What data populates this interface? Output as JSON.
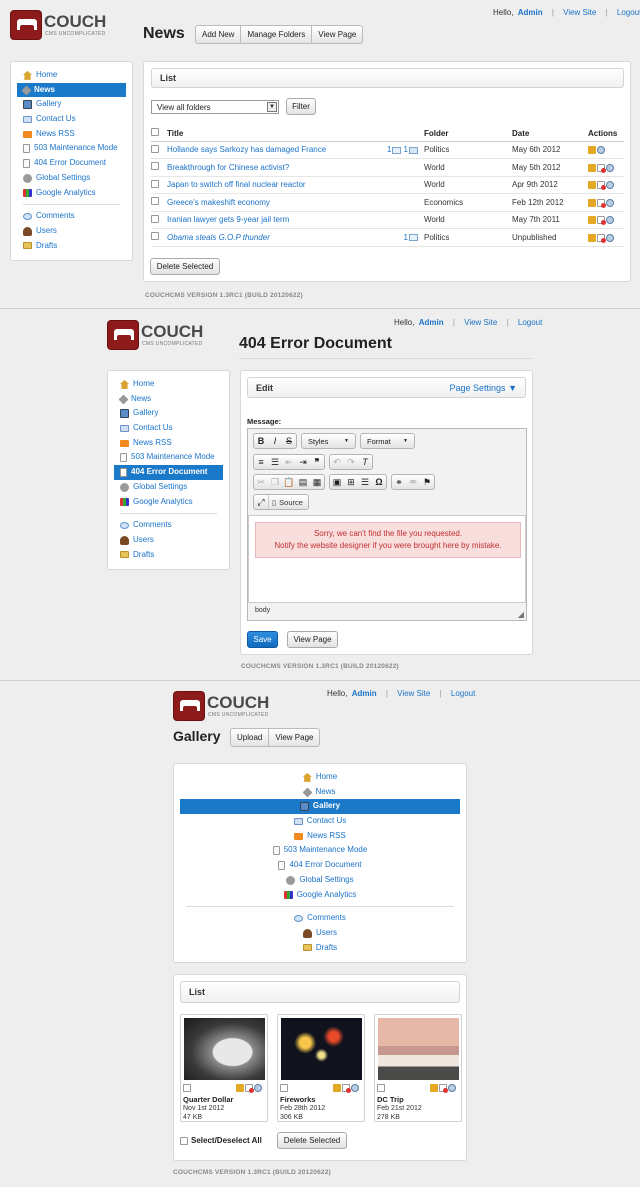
{
  "logo": {
    "text": "COUCH",
    "tagline": "CMS UNCOMPLICATED"
  },
  "account": {
    "greeting": "Hello,",
    "user": "Admin",
    "view_site": "View Site",
    "logout": "Logout"
  },
  "nav": {
    "items": [
      {
        "label": "Home",
        "icon": "home-icon"
      },
      {
        "label": "News",
        "icon": "tag-icon"
      },
      {
        "label": "Gallery",
        "icon": "gallery-icon"
      },
      {
        "label": "Contact Us",
        "icon": "mail-icon"
      },
      {
        "label": "News RSS",
        "icon": "rss-icon"
      },
      {
        "label": "503 Maintenance Mode",
        "icon": "document-icon"
      },
      {
        "label": "404 Error Document",
        "icon": "document-icon"
      },
      {
        "label": "Global Settings",
        "icon": "gear-icon"
      },
      {
        "label": "Google Analytics",
        "icon": "chart-icon"
      }
    ],
    "extra": [
      {
        "label": "Comments",
        "icon": "comment-icon"
      },
      {
        "label": "Users",
        "icon": "user-icon"
      },
      {
        "label": "Drafts",
        "icon": "folder-icon"
      }
    ]
  },
  "footer": "COUCHCMS VERSION 1.3RC1 (BUILD 20120622)",
  "news": {
    "title": "News",
    "buttons": [
      "Add New",
      "Manage Folders",
      "View Page"
    ],
    "panel_title": "List",
    "folder_select": "View all folders",
    "filter_label": "Filter",
    "columns": {
      "title": "Title",
      "folder": "Folder",
      "date": "Date",
      "actions": "Actions"
    },
    "rows": [
      {
        "title": "Hollande says Sarkozy has damaged France",
        "comments_a": "1",
        "comments_b": "1",
        "folder": "Politics",
        "date": "May 6th 2012",
        "italic": false
      },
      {
        "title": "Breakthrough for Chinese activist?",
        "comments_a": "",
        "comments_b": "",
        "folder": "World",
        "date": "May 5th 2012",
        "italic": false
      },
      {
        "title": "Japan to switch off final nuclear reactor",
        "comments_a": "",
        "comments_b": "",
        "folder": "World",
        "date": "Apr 9th 2012",
        "italic": false
      },
      {
        "title": "Greece's makeshift economy",
        "comments_a": "",
        "comments_b": "",
        "folder": "Economics",
        "date": "Feb 12th 2012",
        "italic": false
      },
      {
        "title": "Iranian lawyer gets 9-year jail term",
        "comments_a": "",
        "comments_b": "",
        "folder": "World",
        "date": "May 7th 2011",
        "italic": false
      },
      {
        "title": "Obama steals G.O.P thunder",
        "comments_a": "1",
        "comments_b": "",
        "folder": "Politics",
        "date": "Unpublished",
        "italic": true
      }
    ],
    "delete_label": "Delete Selected"
  },
  "error_doc": {
    "title": "404 Error Document",
    "panel_title": "Edit",
    "page_settings": "Page Settings",
    "message_label": "Message:",
    "styles_label": "Styles",
    "format_label": "Format",
    "source_label": "Source",
    "message_line1": "Sorry, we can't find the file you requested.",
    "message_line2": "Notify the website designer if you were brought here by mistake.",
    "status_path": "body",
    "save_label": "Save",
    "view_label": "View Page"
  },
  "gallery": {
    "title": "Gallery",
    "buttons": [
      "Upload",
      "View Page"
    ],
    "panel_title": "List",
    "items": [
      {
        "name": "Quarter Dollar",
        "date": "Nov 1st 2012",
        "size": "47 KB"
      },
      {
        "name": "Fireworks",
        "date": "Feb 28th 2012",
        "size": "306 KB"
      },
      {
        "name": "DC Trip",
        "date": "Feb 21st 2012",
        "size": "278 KB"
      }
    ],
    "select_all": "Select/Deselect All",
    "delete_label": "Delete Selected"
  }
}
